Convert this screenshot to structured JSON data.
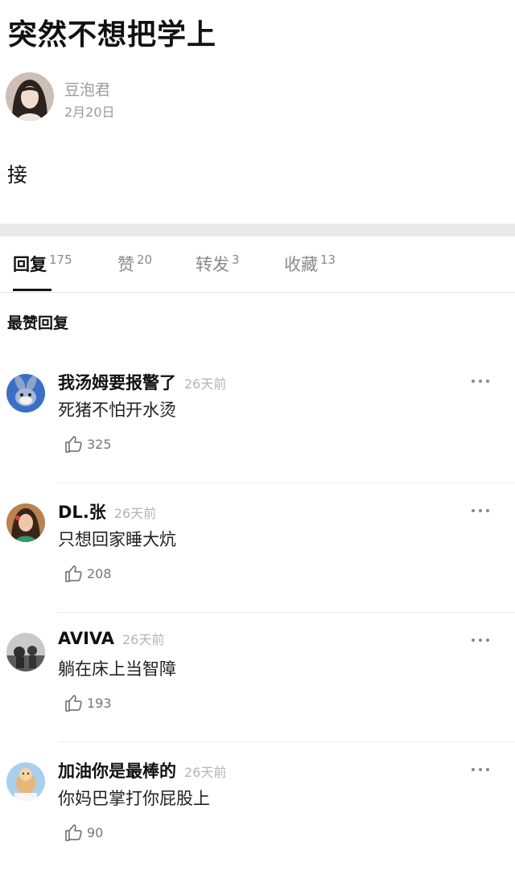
{
  "post": {
    "title": "突然不想把学上",
    "author": "豆泡君",
    "date": "2月20日",
    "body": "接"
  },
  "tabs": [
    {
      "label": "回复",
      "count": "175",
      "active": true
    },
    {
      "label": "赞",
      "count": "20"
    },
    {
      "label": "转发",
      "count": "3"
    },
    {
      "label": "收藏",
      "count": "13"
    }
  ],
  "section_label": "最赞回复",
  "comments": [
    {
      "name": "我汤姆要报警了",
      "time": "26天前",
      "text": "死猪不怕开水烫",
      "likes": "325"
    },
    {
      "name": "DL.张",
      "time": "26天前",
      "text": "只想回家睡大炕",
      "likes": "208"
    },
    {
      "name": "AVIVA",
      "time": "26天前",
      "text": "躺在床上当智障",
      "likes": "193"
    },
    {
      "name": "加油你是最棒的",
      "time": "26天前",
      "text": "你妈巴掌打你屁股上",
      "likes": "90"
    }
  ],
  "icons": {
    "more": "more-dots-icon",
    "like": "thumb-up-icon"
  }
}
